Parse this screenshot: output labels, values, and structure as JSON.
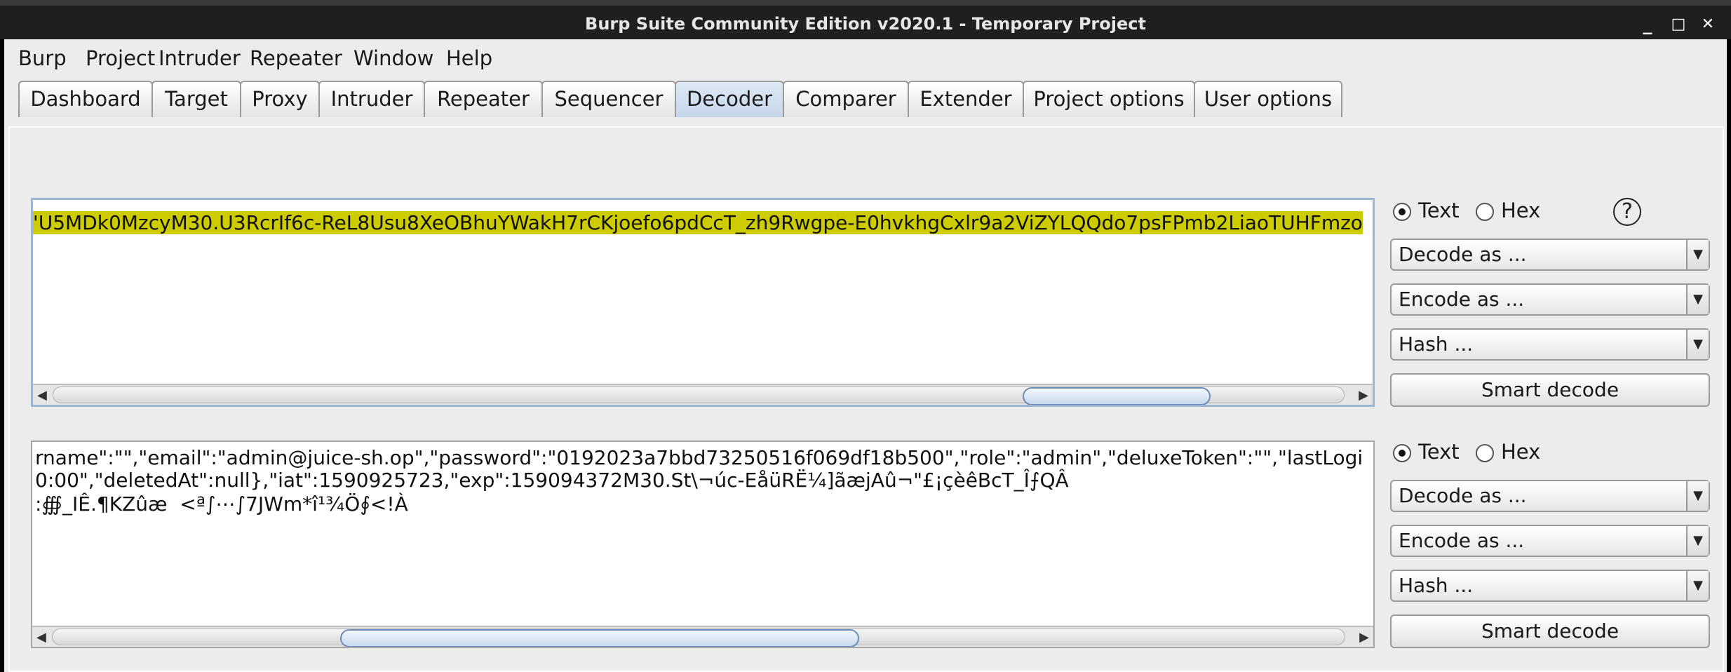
{
  "window": {
    "title": "Burp Suite Community Edition v2020.1 - Temporary Project",
    "controls": {
      "minimize": "_",
      "maximize": "□",
      "close": "✕"
    }
  },
  "menu": [
    "Burp",
    "Project",
    "Intruder",
    "Repeater",
    "Window",
    "Help"
  ],
  "tabs": [
    "Dashboard",
    "Target",
    "Proxy",
    "Intruder",
    "Repeater",
    "Sequencer",
    "Decoder",
    "Comparer",
    "Extender",
    "Project options",
    "User options"
  ],
  "active_tab": "Decoder",
  "decoder": {
    "panel1": {
      "lines": [
        "'U5MDk0MzcyM30.U3RcrIf6c-ReL8Usu8XeOBhuYWakH7rCKjoefo6pdCcT_zh9Rwgpe-E0hvkhgCxlr9a2ViZYLQQdo7psFPmb2LiaoTUHFmzo"
      ],
      "text_label": "Text",
      "hex_label": "Hex",
      "selected_mode": "Text",
      "decode_label": "Decode as ...",
      "encode_label": "Encode as ...",
      "hash_label": "Hash ...",
      "smart_label": "Smart decode"
    },
    "panel2": {
      "lines": [
        "rname\":\"\",\"email\":\"admin@juice-sh.op\",\"password\":\"0192023a7bbd73250516f069df18b500\",\"role\":\"admin\",\"deluxeToken\":\"\",\"lastLogi",
        "0:00\",\"deletedAt\":null},\"iat\":1590925723,\"exp\":159094372M30.St\\¬úc-EåüRË¼]ãæjAû¬\"£¡çèêBcT_Î⨍QÂ",
        ":∰_IÊ.¶KZûæ  <ª∫⋯∫7JWm*î¹¾Ö∮<!À"
      ],
      "text_label": "Text",
      "hex_label": "Hex",
      "selected_mode": "Text",
      "decode_label": "Decode as ...",
      "encode_label": "Encode as ...",
      "hash_label": "Hash ...",
      "smart_label": "Smart decode"
    }
  },
  "icons": {
    "help": "?",
    "scroll_left": "◀",
    "scroll_right": "▶",
    "dropdown": "▼"
  }
}
